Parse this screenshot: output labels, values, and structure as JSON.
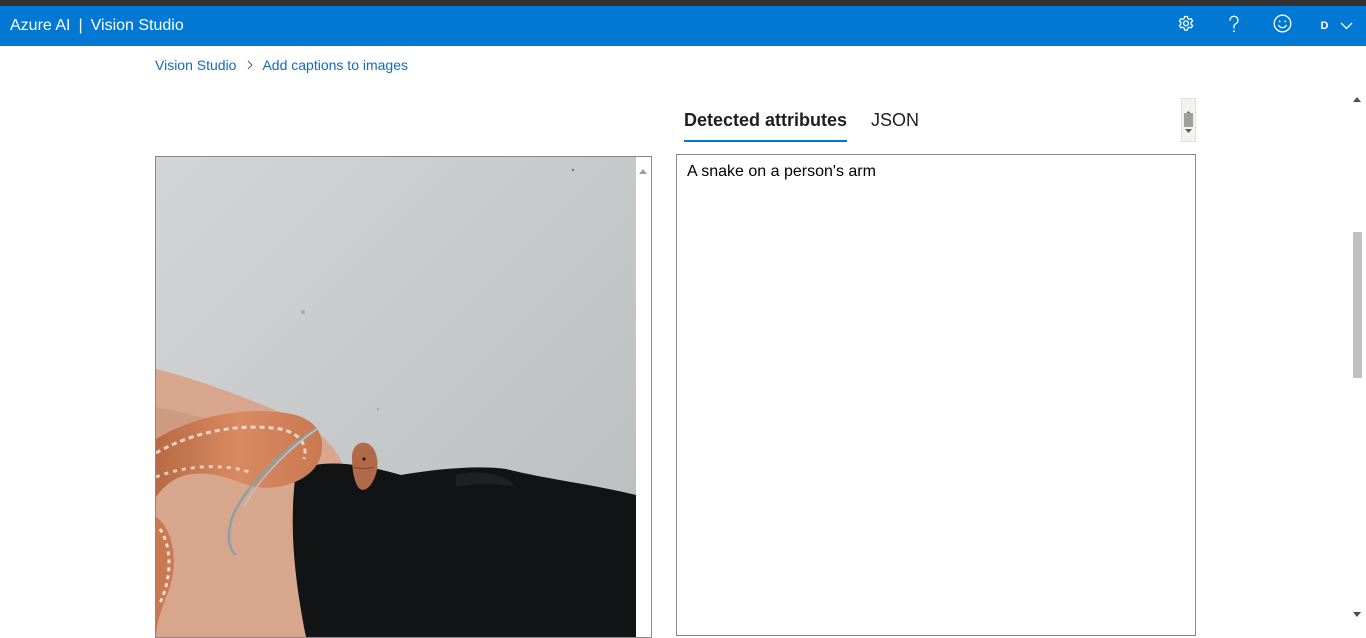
{
  "header": {
    "product": "Azure AI",
    "separator": "|",
    "title": "Vision Studio",
    "user_initial": "D"
  },
  "icons": {
    "settings": "gear-icon",
    "help": "question-mark-icon",
    "feedback": "smiley-icon",
    "account_menu": "chevron-down-icon"
  },
  "breadcrumb": {
    "root": "Vision Studio",
    "current": "Add captions to images"
  },
  "tabs": [
    {
      "label": "Detected attributes",
      "selected": true
    },
    {
      "label": "JSON",
      "selected": false
    }
  ],
  "result": {
    "caption": "A snake on a person's arm"
  },
  "colors": {
    "header_bg": "#0078d4",
    "top_strip": "#323130",
    "link": "#0f6cbd",
    "tab_underline": "#0078d4"
  }
}
